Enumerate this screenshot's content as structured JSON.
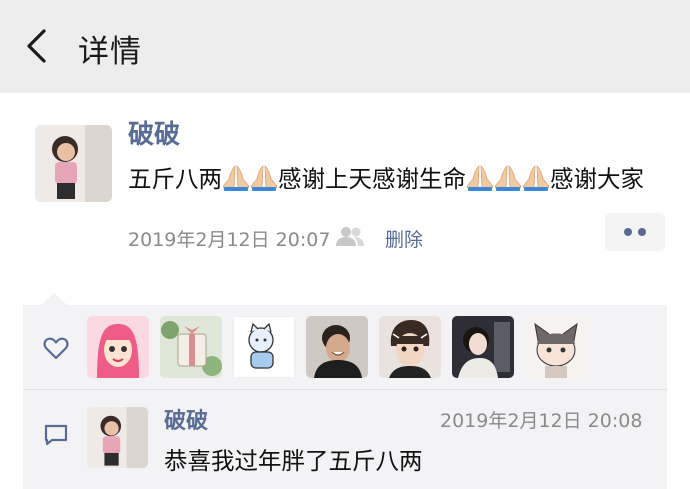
{
  "header": {
    "title": "详情",
    "back_icon": "chevron-left-icon"
  },
  "post": {
    "author": "破破",
    "content": {
      "part1": "五斤八两",
      "part2": "感谢上天感谢生命",
      "part3": "感谢大家",
      "emoji": "praying-hands-emoji"
    },
    "timestamp": "2019年2月12日 20:07",
    "privacy_icon": "group-icon",
    "delete_label": "删除",
    "more_icon": "more-dots-icon"
  },
  "likes": {
    "icon": "heart-icon",
    "avatars": [
      "pink-hair-girl",
      "gift-box",
      "cartoon-cat-drawing",
      "laughing-man",
      "boy-with-earphones",
      "girl-in-car",
      "cartoon-cat-boy"
    ]
  },
  "comment": {
    "icon": "comment-icon",
    "author": "破破",
    "timestamp": "2019年2月12日 20:08",
    "text": "恭喜我过年胖了五斤八两"
  },
  "colors": {
    "link": "#576b95",
    "navbar": "#ededed",
    "panel": "#f3f3f5"
  }
}
